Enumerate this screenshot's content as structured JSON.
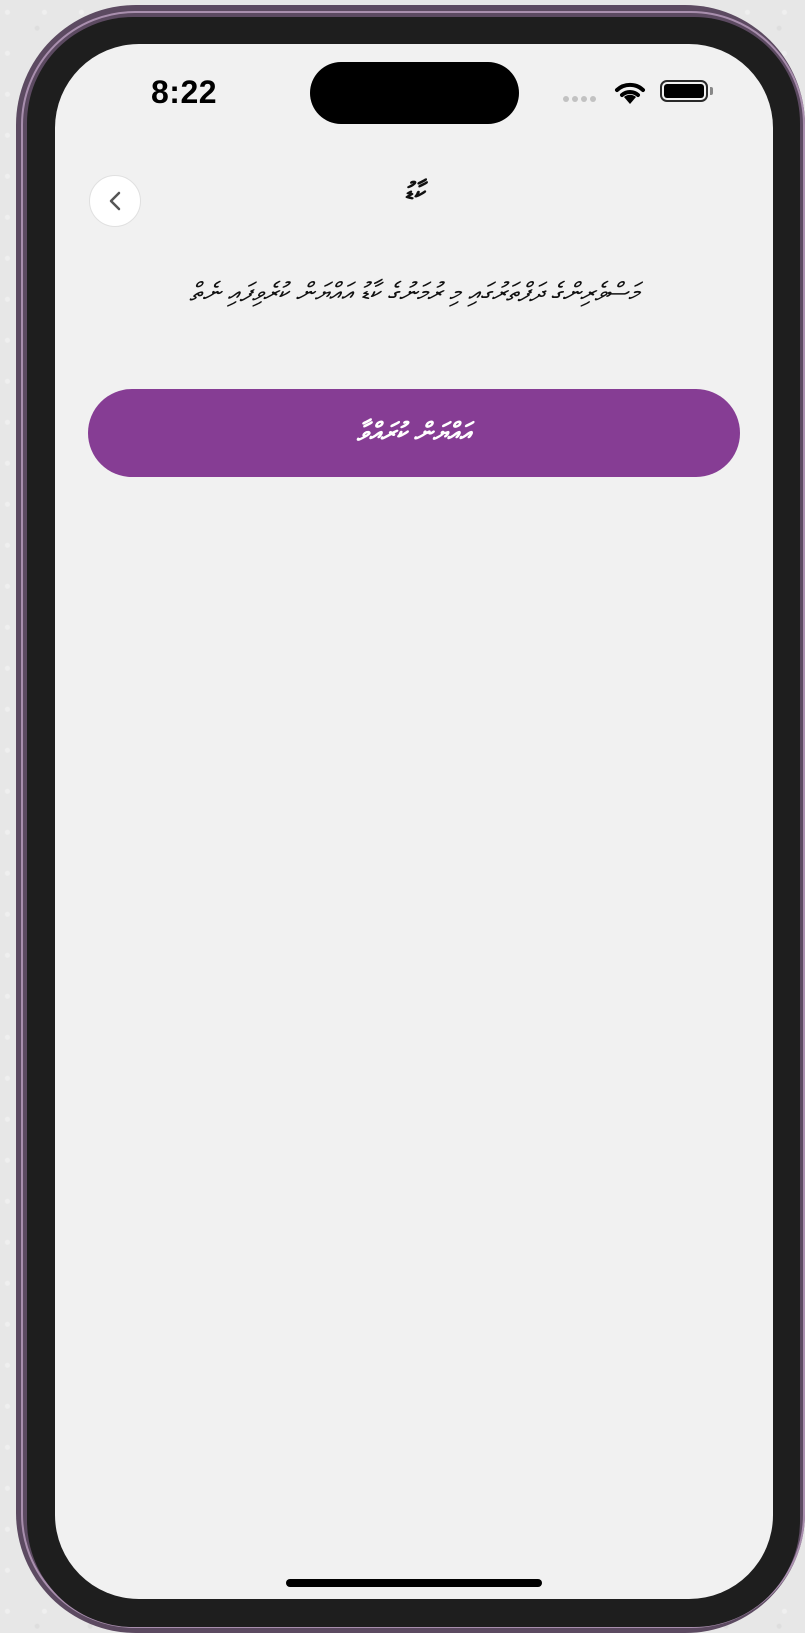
{
  "status_bar": {
    "time": "8:22"
  },
  "header": {
    "back_icon": "chevron-left-icon",
    "title": "ކާޑު"
  },
  "content": {
    "message": "މަސްވެރިންގެ ދަފްތަރުގައި މި ރުމަނުގެ ކާޑު އައްޔަން ކުރެވިފައި ނެތް",
    "button_label": "އައްޔަން ކުރައްވާ"
  },
  "colors": {
    "accent": "#863d94",
    "screen_background": "#f1f1f1",
    "device_frame": "#5c4a61"
  }
}
